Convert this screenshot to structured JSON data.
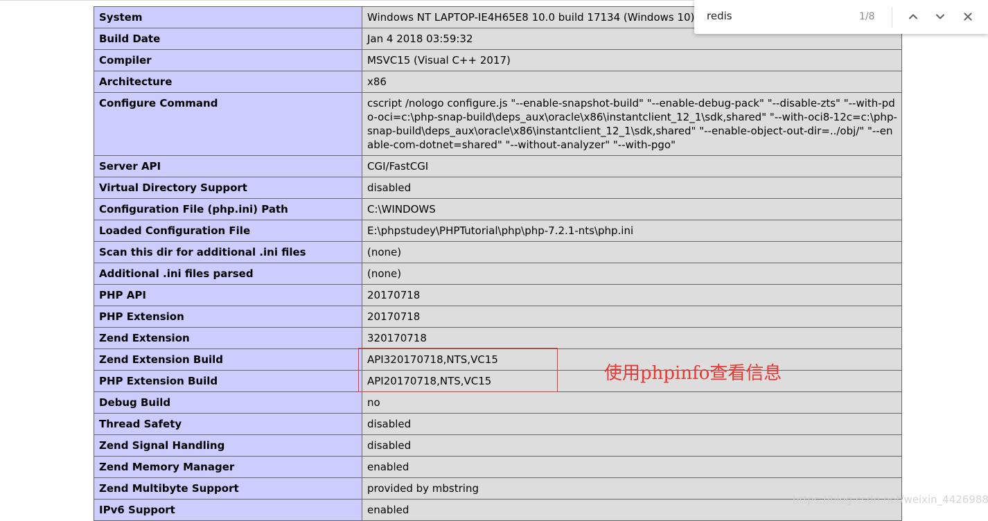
{
  "info_table": {
    "rows": [
      {
        "label": "System",
        "value": "Windows NT LAPTOP-IE4H65E8 10.0 build 17134 (Windows 10) i586"
      },
      {
        "label": "Build Date",
        "value": "Jan 4 2018 03:59:32"
      },
      {
        "label": "Compiler",
        "value": "MSVC15 (Visual C++ 2017)"
      },
      {
        "label": "Architecture",
        "value": "x86"
      },
      {
        "label": "Configure Command",
        "value": "cscript /nologo configure.js \"--enable-snapshot-build\" \"--enable-debug-pack\" \"--disable-zts\" \"--with-pdo-oci=c:\\php-snap-build\\deps_aux\\oracle\\x86\\instantclient_12_1\\sdk,shared\" \"--with-oci8-12c=c:\\php-snap-build\\deps_aux\\oracle\\x86\\instantclient_12_1\\sdk,shared\" \"--enable-object-out-dir=../obj/\" \"--enable-com-dotnet=shared\" \"--without-analyzer\" \"--with-pgo\""
      },
      {
        "label": "Server API",
        "value": "CGI/FastCGI"
      },
      {
        "label": "Virtual Directory Support",
        "value": "disabled"
      },
      {
        "label": "Configuration File (php.ini) Path",
        "value": "C:\\WINDOWS"
      },
      {
        "label": "Loaded Configuration File",
        "value": "E:\\phpstudey\\PHPTutorial\\php\\php-7.2.1-nts\\php.ini"
      },
      {
        "label": "Scan this dir for additional .ini files",
        "value": "(none)"
      },
      {
        "label": "Additional .ini files parsed",
        "value": "(none)"
      },
      {
        "label": "PHP API",
        "value": "20170718"
      },
      {
        "label": "PHP Extension",
        "value": "20170718"
      },
      {
        "label": "Zend Extension",
        "value": "320170718"
      },
      {
        "label": "Zend Extension Build",
        "value": "API320170718,NTS,VC15"
      },
      {
        "label": "PHP Extension Build",
        "value": "API20170718,NTS,VC15"
      },
      {
        "label": "Debug Build",
        "value": "no"
      },
      {
        "label": "Thread Safety",
        "value": "disabled"
      },
      {
        "label": "Zend Signal Handling",
        "value": "disabled"
      },
      {
        "label": "Zend Memory Manager",
        "value": "enabled"
      },
      {
        "label": "Zend Multibyte Support",
        "value": "provided by mbstring"
      },
      {
        "label": "IPv6 Support",
        "value": "enabled"
      }
    ]
  },
  "annotation": {
    "text": "使用phpinfo查看信息",
    "color": "#e53935"
  },
  "find_bar": {
    "query": "redis",
    "count": "1/8",
    "prev_icon": "chevron-up-icon",
    "next_icon": "chevron-down-icon",
    "close_icon": "close-icon"
  },
  "watermark": {
    "text": "https://blog.csdn.net/weixin_44269886"
  },
  "colors": {
    "label_cell": "#ccccff",
    "value_cell": "#dddddd",
    "highlight_box": "#e53935"
  }
}
